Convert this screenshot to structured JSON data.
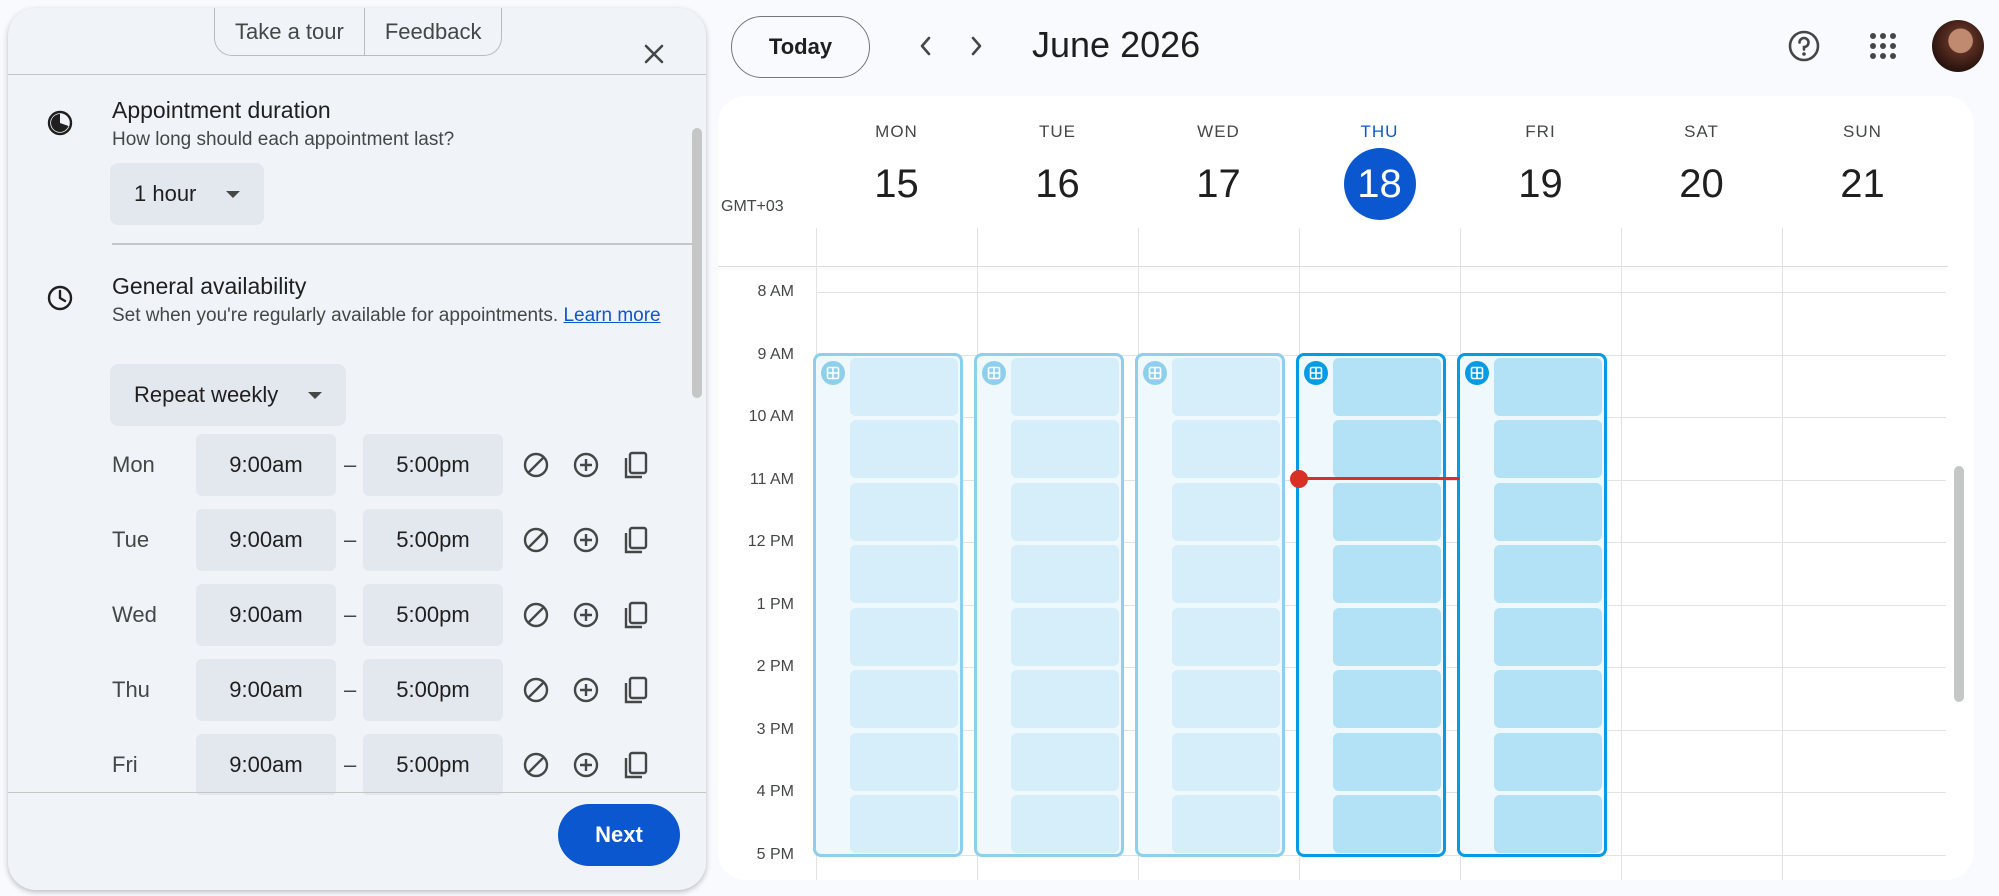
{
  "panel": {
    "tour_label": "Take a tour",
    "feedback_label": "Feedback",
    "duration": {
      "title": "Appointment duration",
      "subtitle": "How long should each appointment last?",
      "value": "1 hour"
    },
    "availability": {
      "title": "General availability",
      "subtitle": "Set when you're regularly available for appointments.",
      "learn_more": "Learn more",
      "repeat_value": "Repeat weekly",
      "separator": "–",
      "days": [
        {
          "day": "Mon",
          "start": "9:00am",
          "end": "5:00pm"
        },
        {
          "day": "Tue",
          "start": "9:00am",
          "end": "5:00pm"
        },
        {
          "day": "Wed",
          "start": "9:00am",
          "end": "5:00pm"
        },
        {
          "day": "Thu",
          "start": "9:00am",
          "end": "5:00pm"
        },
        {
          "day": "Fri",
          "start": "9:00am",
          "end": "5:00pm"
        }
      ]
    },
    "next_label": "Next"
  },
  "header": {
    "today_label": "Today",
    "month_title": "June 2026"
  },
  "calendar": {
    "timezone": "GMT+03",
    "days": [
      {
        "name": "MON",
        "num": "15"
      },
      {
        "name": "TUE",
        "num": "16"
      },
      {
        "name": "WED",
        "num": "17"
      },
      {
        "name": "THU",
        "num": "18"
      },
      {
        "name": "FRI",
        "num": "19"
      },
      {
        "name": "SAT",
        "num": "20"
      },
      {
        "name": "SUN",
        "num": "21"
      }
    ],
    "today_name": "THU",
    "hours": [
      "8 AM",
      "9 AM",
      "10 AM",
      "11 AM",
      "12 PM",
      "1 PM",
      "2 PM",
      "3 PM",
      "4 PM",
      "5 PM"
    ],
    "availability_days": [
      "MON",
      "TUE",
      "WED",
      "THU",
      "FRI"
    ],
    "availability_start": "9 AM",
    "availability_end": "5 PM",
    "slots_per_day": 8,
    "current_time": "11 AM"
  },
  "colors": {
    "accent": "#0b57d0",
    "slot_border": "#8fcfee",
    "slot_border_active": "#039be5",
    "now_indicator": "#d93025"
  }
}
